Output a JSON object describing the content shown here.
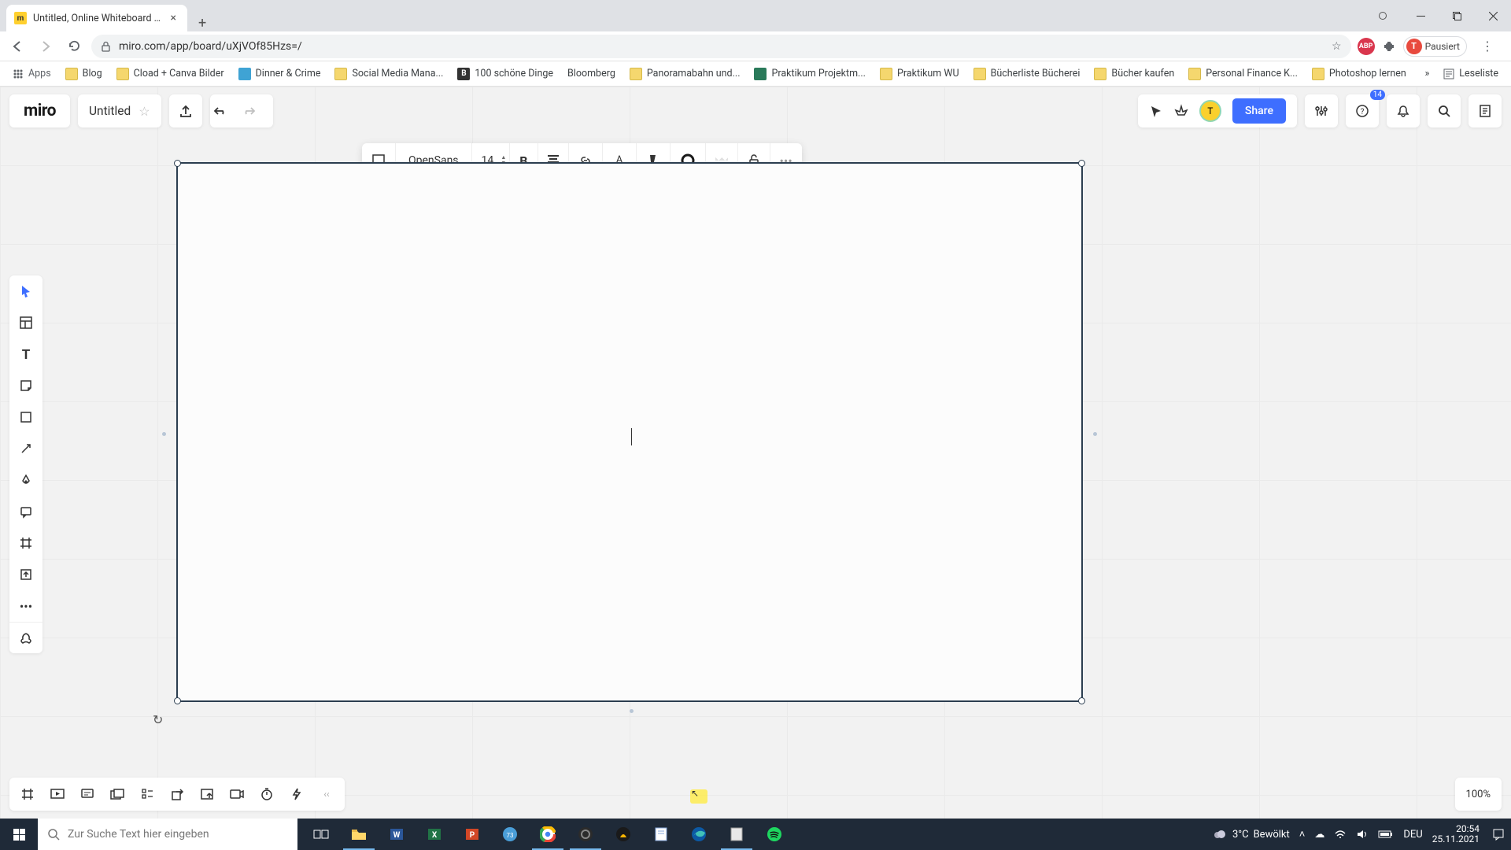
{
  "browser": {
    "tab_title": "Untitled, Online Whiteboard for",
    "url": "miro.com/app/board/uXjVOf85Hzs=/",
    "profile_label": "Pausiert",
    "profile_initial": "T",
    "bookmarks": [
      "Apps",
      "Blog",
      "Cload + Canva Bilder",
      "Dinner & Crime",
      "Social Media Mana...",
      "100 schöne Dinge",
      "Bloomberg",
      "Panoramabahn und...",
      "Praktikum Projektm...",
      "Praktikum WU",
      "Bücherliste Bücherei",
      "Bücher kaufen",
      "Personal Finance K...",
      "Photoshop lernen"
    ],
    "reading_list": "Leseliste"
  },
  "miro": {
    "brand": "miro",
    "title": "Untitled",
    "share": "Share",
    "notif_count": "14",
    "font": "OpenSans",
    "font_size": "14",
    "zoom": "100%"
  },
  "taskbar": {
    "search_placeholder": "Zur Suche Text hier eingeben",
    "weather_temp": "3°C",
    "weather_desc": "Bewölkt",
    "lang": "DEU",
    "time": "20:54",
    "date": "25.11.2021"
  }
}
